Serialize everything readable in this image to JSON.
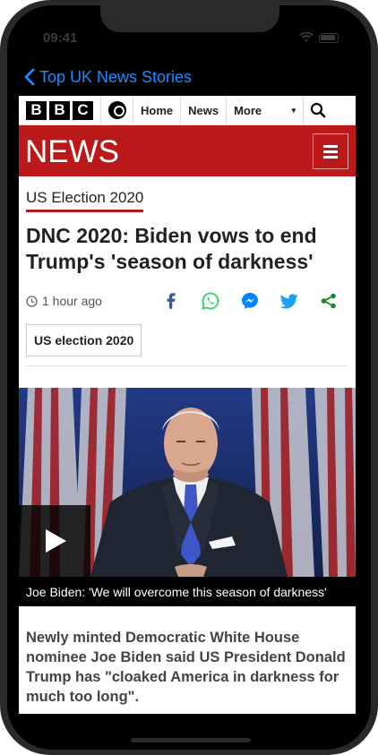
{
  "status_bar": {
    "time": "09:41"
  },
  "nav": {
    "back_label": "Top UK News Stories"
  },
  "bbc_bar": {
    "logo_letters": [
      "B",
      "B",
      "C"
    ],
    "home_label": "Home",
    "news_label": "News",
    "more_label": "More",
    "more_caret": "▾"
  },
  "banner": {
    "title": "NEWS"
  },
  "article": {
    "section": "US Election 2020",
    "headline": "DNC 2020: Biden vows to end Trump's 'season of darkness'",
    "timestamp": "1 hour ago",
    "tag": "US election 2020",
    "video_caption": "Joe Biden: 'We will overcome this season of darkness'",
    "summary": "Newly minted Democratic White House nominee Joe Biden said US President Donald Trump has \"cloaked America in darkness for much too long\"."
  },
  "share_icons": [
    "facebook-icon",
    "whatsapp-icon",
    "messenger-icon",
    "twitter-icon",
    "share-icon"
  ],
  "colors": {
    "brand_red": "#bb1919",
    "ios_blue": "#1a8cff",
    "facebook": "#3b5998",
    "whatsapp": "#25d366",
    "messenger": "#0084ff",
    "twitter": "#1da1f2",
    "share_green": "#118a2e"
  }
}
